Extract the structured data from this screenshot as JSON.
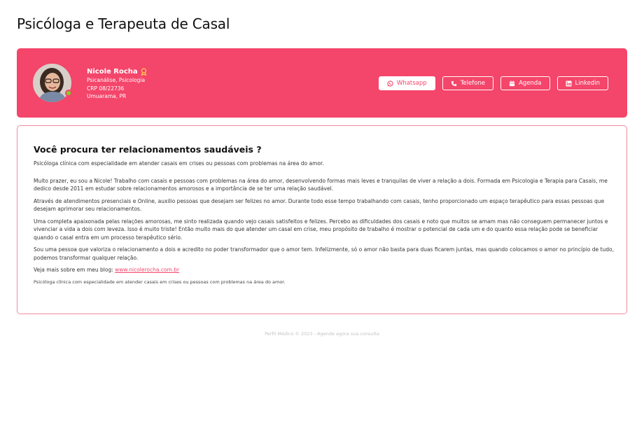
{
  "page": {
    "title": "Psicóloga e Terapeuta de Casal"
  },
  "profile": {
    "name": "Nicole Rocha",
    "specialties": "Psicanálise, Psicologia",
    "crp": "CRP 08/22736",
    "location": "Umuarama, PR",
    "online": true,
    "badge_icon": "award-ribbon-icon",
    "accent_color": "#f4456a",
    "online_color": "#7ed321"
  },
  "actions": [
    {
      "label": "Whatsapp",
      "icon": "whatsapp-icon"
    },
    {
      "label": "Telefone",
      "icon": "phone-icon"
    },
    {
      "label": "Agenda",
      "icon": "calendar-icon"
    },
    {
      "label": "Linkedin",
      "icon": "linkedin-icon"
    }
  ],
  "about": {
    "heading": "Você procura ter relacionamentos saudáveis ?",
    "lead": "Psicóloga clínica com especialidade em atender casais em crises ou pessoas com problemas na área do amor.",
    "paragraphs": [
      "Muito prazer, eu sou a Nicole! Trabalho com casais e pessoas com problemas na área do amor, desenvolvendo formas mais leves e tranquilas de viver a relação a dois. Formada em Psicologia e Terapia para Casais, me dedico desde 2011 em estudar sobre relacionamentos amorosos e a importância de se ter uma relação saudável.",
      "Através de atendimentos presenciais e Online, auxilio pessoas que desejam ser felizes no amor. Durante todo esse tempo trabalhando com casais, tenho proporcionado um espaço terapêutico para essas pessoas que desejam aprimorar seu relacionamentos.",
      "Uma completa apaixonada pelas relações amorosas, me sinto realizada quando vejo casais satisfeitos e felizes. Percebo as dificuldades dos casais e noto que muitos se amam mas não conseguem permanecer juntos e vivenciar a vida a dois com leveza. Isso é muito triste! Então muito mais do que atender um casal em crise, meu propósito de trabalho é mostrar o potencial de cada um e do quanto essa relação pode se beneficiar quando o casal entra em um processo terapêutico sério.",
      "Sou uma pessoa que valoriza o relacionamento a dois e acredito no poder transformador que o amor tem. Infelizmente, só o amor não basta para duas ficarem juntas, mas quando colocamos o amor no princípio de tudo, podemos transformar qualquer relação."
    ],
    "blog_prefix": "Veja mais sobre em meu blog: ",
    "blog_link": "www.nicolerocha.com.br",
    "note": "Psicóloga clínica com especialidade em atender casais em crises ou pessoas com problemas na área do amor."
  },
  "footer": {
    "text": "Perfil Médico © 2023 - Agende agora sua consulta"
  }
}
